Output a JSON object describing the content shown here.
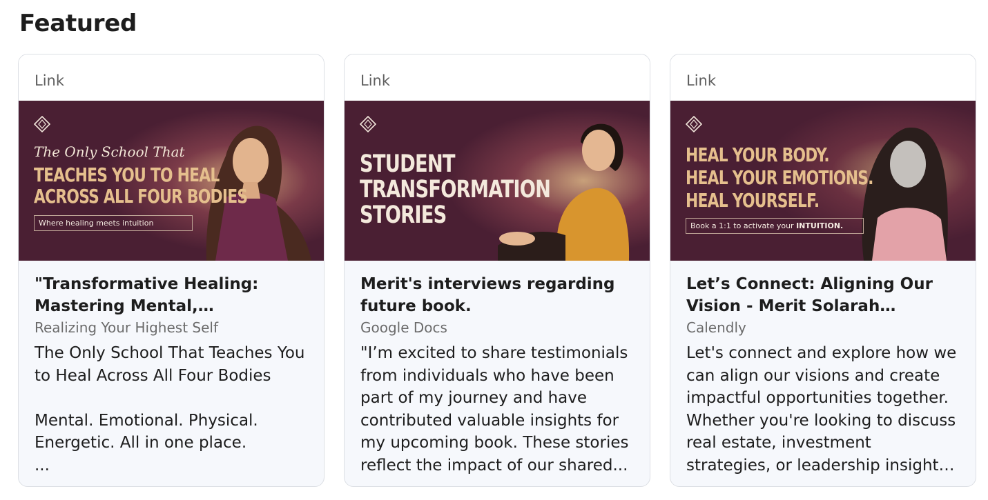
{
  "section": {
    "title": "Featured"
  },
  "cards": [
    {
      "type_label": "Link",
      "banner": {
        "script": "The Only School That",
        "headline": [
          "TEACHES YOU TO HEAL",
          "ACROSS ALL FOUR BODIES"
        ],
        "tagline": "Where healing meets intuition"
      },
      "title": "\"Transformative Healing: Mastering Mental, Emotional,...",
      "source": "Realizing Your Highest Self",
      "description": "The Only School That Teaches You to Heal Across All Four Bodies\n\nMental. Emotional. Physical. Energetic. All in one place.\n..."
    },
    {
      "type_label": "Link",
      "banner": {
        "headline": [
          "STUDENT",
          "TRANSFORMATION",
          "STORIES"
        ]
      },
      "title": "Merit's interviews regarding future book.",
      "source": "Google Docs",
      "description": "\"I’m excited to share testimonials from individuals who have been part of my journey and have contributed valuable insights for my upcoming book. These stories reflect the impact of our shared..."
    },
    {
      "type_label": "Link",
      "banner": {
        "headline": [
          "HEAL YOUR BODY.",
          "HEAL YOUR EMOTIONS.",
          "HEAL YOURSELF."
        ],
        "tagline_prefix": "Book a 1:1 to activate your ",
        "tagline_bold": "INTUITION."
      },
      "title": "Let’s Connect: Aligning Our Vision - Merit Solarah Aureong",
      "source": "Calendly",
      "description": "Let's connect and explore how we can align our visions and create impactful opportunities together. Whether you're looking to discuss real estate, investment strategies, or leadership insights, I’m eager ..."
    }
  ]
}
